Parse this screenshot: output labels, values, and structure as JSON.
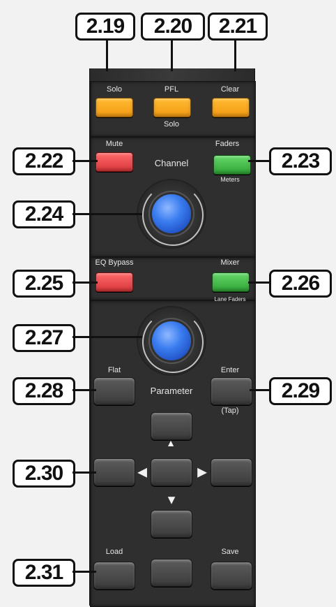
{
  "callouts": {
    "c219": "2.19",
    "c220": "2.20",
    "c221": "2.21",
    "c222": "2.22",
    "c223": "2.23",
    "c224": "2.24",
    "c225": "2.25",
    "c226": "2.26",
    "c227": "2.27",
    "c228": "2.28",
    "c229": "2.29",
    "c230": "2.30",
    "c231": "2.31"
  },
  "labels": {
    "solo": "Solo",
    "pfl": "PFL",
    "pfl_sub": "Solo",
    "clear": "Clear",
    "mute": "Mute",
    "faders": "Faders",
    "faders_sub": "Meters",
    "channel": "Channel",
    "eq_bypass": "EQ Bypass",
    "mixer": "Mixer",
    "mixer_sub": "Lane Faders",
    "flat": "Flat",
    "enter": "Enter",
    "parameter": "Parameter",
    "tap": "(Tap)",
    "load": "Load",
    "save": "Save"
  },
  "icons": {
    "arrow_left": "◀",
    "arrow_right": "▶",
    "arrow_down": "▼",
    "arrow_up": "▲"
  }
}
